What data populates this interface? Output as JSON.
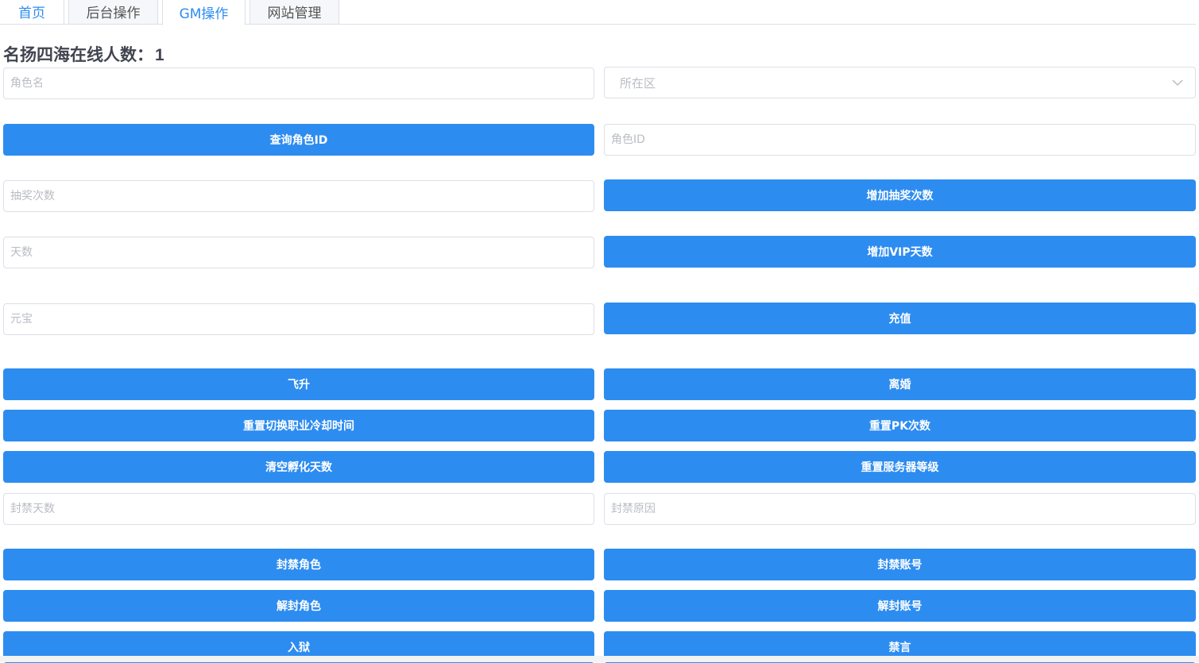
{
  "tabs": [
    "首页",
    "后台操作",
    "GM操作",
    "网站管理"
  ],
  "title": {
    "label": "名扬四海在线人数：",
    "count": "1"
  },
  "fields": {
    "role_name": "角色名",
    "zone": "所在区",
    "role_id": "角色ID",
    "lottery_count": "抽奖次数",
    "days": "天数",
    "yuanbao": "元宝",
    "ban_days": "封禁天数",
    "ban_reason": "封禁原因"
  },
  "buttons": {
    "query_role_id": "查询角色ID",
    "add_lottery": "增加抽奖次数",
    "add_vip_days": "增加VIP天数",
    "recharge": "充值",
    "ascend": "飞升",
    "divorce": "离婚",
    "reset_job_cooldown": "重置切换职业冷却时间",
    "reset_pk": "重置PK次数",
    "clear_incubation": "清空孵化天数",
    "reset_server_level": "重置服务器等级",
    "ban_role": "封禁角色",
    "ban_account": "封禁账号",
    "unban_role": "解封角色",
    "unban_account": "解封账号",
    "jail": "入狱",
    "mute": "禁言"
  },
  "colors": {
    "primary": "#2d8cf0",
    "border": "#dcdfe6",
    "placeholder": "#b9bcc3"
  },
  "icons": {
    "zone_select": "chevron-down-icon"
  }
}
